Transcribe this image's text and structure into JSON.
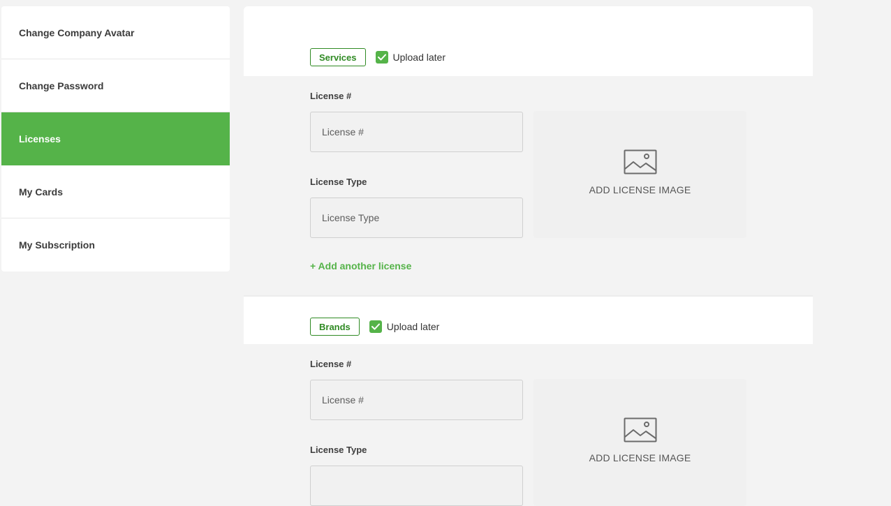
{
  "sidebar": {
    "items": [
      {
        "label": "Change Company Avatar",
        "active": false
      },
      {
        "label": "Change Password",
        "active": false
      },
      {
        "label": "Licenses",
        "active": true
      },
      {
        "label": "My Cards",
        "active": false
      },
      {
        "label": "My Subscription",
        "active": false
      }
    ]
  },
  "sections": [
    {
      "tag": "Services",
      "upload_later_label": "Upload later",
      "upload_later_checked": true,
      "license_number_label": "License #",
      "license_number_placeholder": "License #",
      "license_type_label": "License Type",
      "license_type_placeholder": "License Type",
      "image_label": "ADD LICENSE IMAGE",
      "add_another_label": "+ Add another license"
    },
    {
      "tag": "Brands",
      "upload_later_label": "Upload later",
      "upload_later_checked": true,
      "license_number_label": "License #",
      "license_number_placeholder": "License #",
      "license_type_label": "License Type",
      "image_label": "ADD LICENSE IMAGE"
    }
  ],
  "colors": {
    "accent": "#55b349",
    "tag_border": "#2f8a23",
    "background": "#f3f3f3"
  },
  "icons": {
    "check": "check-icon",
    "image": "image-placeholder-icon"
  }
}
